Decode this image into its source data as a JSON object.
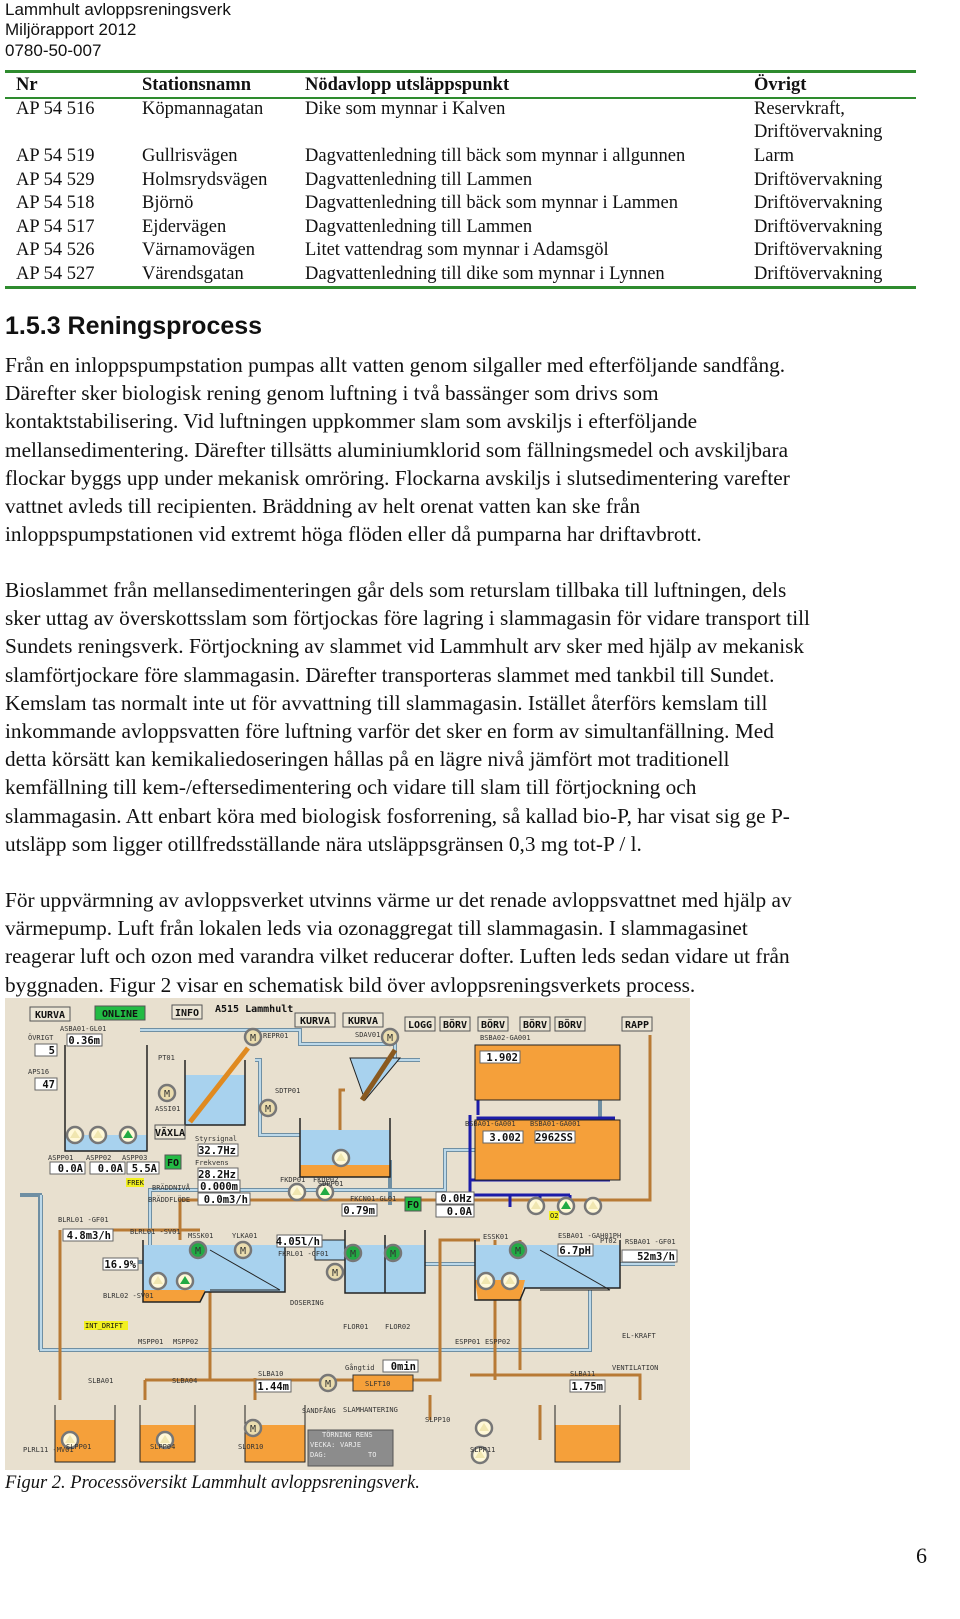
{
  "header": {
    "line1": "Lammhult avloppsreningsverk",
    "line2": "Miljörapport 2012",
    "line3": "0780-50-007"
  },
  "table": {
    "columns": [
      "Nr",
      "Stationsnamn",
      "Nödavlopp utsläppspunkt",
      "Övrigt"
    ],
    "rows": [
      [
        "AP 54 516",
        "Köpmannagatan",
        "Dike som mynnar i Kalven",
        "Reservkraft,",
        "Driftövervakning"
      ],
      [
        "AP 54 519",
        "Gullrisvägen",
        "Dagvattenledning till bäck som mynnar i allgunnen",
        "Larm"
      ],
      [
        "AP 54 529",
        "Holmsrydsvägen",
        "Dagvattenledning till Lammen",
        "Driftövervakning"
      ],
      [
        "AP 54 518",
        "Björnö",
        "Dagvattenledning till bäck som mynnar i Lammen",
        "Driftövervakning"
      ],
      [
        "AP 54 517",
        "Ejdervägen",
        "Dagvattenledning till Lammen",
        "Driftövervakning"
      ],
      [
        "AP 54 526",
        "Värnamovägen",
        "Litet vattendrag som mynnar i Adamsgöl",
        "Driftövervakning"
      ],
      [
        "AP 54 527",
        "Värendsgatan",
        "Dagvattenledning till dike som mynnar i Lynnen",
        "Driftövervakning"
      ]
    ]
  },
  "section": {
    "title": "1.5.3 Reningsprocess",
    "paragraphs": [
      [
        "Från en inloppspumpstation pumpas allt vatten genom silgaller med efterföljande sandfång.",
        "Därefter sker biologisk rening genom luftning i två bassänger som drivs som",
        "kontaktstabilisering. Vid luftningen uppkommer slam som avskiljs i efterföljande",
        "mellansedimentering. Därefter tillsätts aluminiumklorid som fällningsmedel och avskiljbara",
        "flockar byggs upp under mekanisk omröring. Flockarna avskiljs i slutsedimentering varefter",
        "vattnet avleds till recipienten. Bräddning av helt orenat vatten kan ske från",
        "inloppspumpstationen vid extremt höga flöden eller då pumparna har driftavbrott."
      ],
      [
        "Bioslammet från mellansedimenteringen går dels som returslam tillbaka till luftningen, dels",
        "sker uttag av överskottsslam som förtjockas före lagring i slammagasin för vidare transport till",
        "Sundets reningsverk. Förtjockning av slammet vid Lammhult arv sker med hjälp av mekanisk",
        "slamförtjockare före slammagasin. Därefter transporteras slammet med tankbil till Sundet.",
        "Kemslam tas normalt inte ut för avvattning till slammagasin. Istället återförs kemslam till",
        "inkommande avloppsvatten före luftning varför det sker en form av simultanfällning. Med",
        "detta körsätt kan kemikaliedoseringen hållas på en lägre nivå jämfört mot traditionell",
        "kemfällning till kem-/eftersedimentering och vidare till slam till förtjockning och",
        "slammagasin. Att enbart köra med biologisk fosforrening, så kallad bio-P, har visat sig ge P-",
        "utsläpp som ligger otillfredsställande nära utsläppsgränsen 0,3 mg tot-P / l."
      ],
      [
        "För uppvärmning av avloppsverket utvinns värme ur det renade avloppsvattnet med hjälp av",
        "värmepump. Luft från lokalen leds via ozonaggregat till slammagasin. I slammagasinet",
        "reagerar luft och ozon med varandra vilket reducerar dofter. Luften leds sedan vidare ut från",
        "byggnaden. Figur 2 visar en schematisk bild över avloppsreningsverkets process."
      ]
    ]
  },
  "diagram": {
    "title": "A515 Lammhult",
    "buttons": {
      "kurva1": "KURVA",
      "online": "ONLINE",
      "info": "INFO",
      "kurva2": "KURVA",
      "kurva3": "KURVA",
      "logg": "LOGG",
      "borv1": "BÖRV",
      "borv2": "BÖRV",
      "borv3": "BÖRV",
      "borv4": "BÖRV",
      "rapp": "RAPP",
      "vaxla": "VÄXLA",
      "fo1": "FO",
      "fo2": "FO"
    },
    "labels": {
      "ovrigt": "ÖVRIGT",
      "aps16": "APS16",
      "asba01": "ASBA01-GL01",
      "pt01": "PT01",
      "repr01": "REPR01",
      "assi01": "ASSI01",
      "sdtp01": "SDTP01",
      "sdav01": "SDAV01",
      "sdpp01": "SDPP01",
      "bsba02": "BSBA02-GA001",
      "bsba01a": "BSBA01-GA001",
      "bsba01b": "BSBA01-GA001",
      "aspp01": "ASPP01",
      "aspp02": "ASPP02",
      "aspp03": "ASPP03",
      "frek": "FREK",
      "styrsignal": "Styrsignal",
      "frekvens": "Frekvens",
      "braddniva": "BRÄDDNIVÅ",
      "braddflode": "BRÄDDFLÖDE",
      "fkdp01": "FKDP01",
      "fkdp02": "FKDP02",
      "fkcn01": "FKCN01-GL01",
      "o2": "O2",
      "blrl01gf": "BLRL01 -GF01",
      "blrl01sv": "BLRL01 -SV01",
      "blrl02sv": "BLRL02 -SV01",
      "int_drift": "INT_DRIFT",
      "mssk01": "MSSK01",
      "ylka01": "YLKA01",
      "fkrl01": "FKRL01 -GF01",
      "dosering": "DOSERING",
      "mspp01": "MSPP01",
      "mspp02": "MSPP02",
      "flor01": "FLOR01",
      "flor02": "FLOR02",
      "essk01": "ESSK01",
      "esba01": "ESBA01 -GAH01PH",
      "pt02": "PT02",
      "rsba01": "RSBA01 -GF01",
      "espp01": "ESPP01",
      "espp02": "ESPP02",
      "elkraft": "EL-KRAFT",
      "ventilation": "VENTILATION",
      "slba01": "SLBA01",
      "slba04": "SLBA04",
      "slba10": "SLBA10",
      "slba11": "SLBA11",
      "gangtid": "Gångtid",
      "slft10": "SLFT10",
      "sandfang": "SANDFÅNG",
      "slamhantering": "SLAMHANTERING",
      "slpp10": "SLPP10",
      "slpp01": "SLPP01",
      "slpp04": "SLPP04",
      "slor10": "SLOR10",
      "slpp11": "SLPP11",
      "plrl11": "PLRL11 -MV01",
      "torning": "TÖRNING RENS",
      "vecka": "VECKA:",
      "dag": "DAG:",
      "varje": "VARJE",
      "to": "TO"
    },
    "values": {
      "ovrigt": "5",
      "aps16": "47",
      "asba01": "0.36m",
      "bsba02": "1.902",
      "bsba01": "3.002",
      "ss": "2962SS",
      "aspp01": "0.0A",
      "aspp02": "0.0A",
      "aspp03": "5.5A",
      "styr": "32.7Hz",
      "frek": "28.2Hz",
      "braddniva": "0.000m",
      "braddflode": "0.0m3/h",
      "fkcn01": "0.79m",
      "hz": "0.0Hz",
      "amp": "0.0A",
      "blrl01": "4.8m3/h",
      "pct": "16.9%",
      "fkrl01": "4.05l/h",
      "ph": "6.7pH",
      "rsba01": "52m3/h",
      "gangtid": "0min",
      "slba10": "1.44m",
      "slba11": "1.75m"
    },
    "colors": {
      "background": "#e8e0cf",
      "water": "#a8d2ee",
      "sludge": "#f5a03a",
      "air": "#1c1ca8",
      "online": "#22bb44"
    }
  },
  "caption": {
    "label": "Figur 2.",
    "text": " Processöversikt Lammhult avloppsreningsverk."
  },
  "page_number": "6"
}
